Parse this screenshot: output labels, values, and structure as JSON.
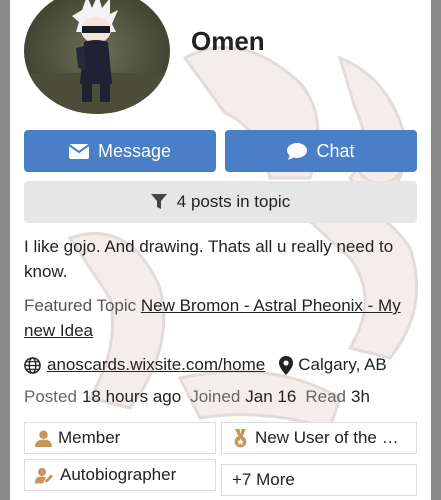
{
  "profile": {
    "username": "Omen",
    "bio": "I like gojo. And drawing. Thats all u really need to know.",
    "featured_label": "Featured Topic",
    "featured_topic": "New Bromon - Astral Pheonix - My new Idea",
    "website": "anoscards.wixsite.com/home",
    "location": "Calgary, AB"
  },
  "actions": {
    "message_label": "Message",
    "chat_label": "Chat",
    "posts_label": "4 posts in topic"
  },
  "stats": {
    "posted_label": "Posted",
    "posted_value": "18 hours ago",
    "joined_label": "Joined",
    "joined_value": "Jan 16",
    "read_label": "Read",
    "read_value": "3h"
  },
  "badges": [
    {
      "label": "Member",
      "icon": "user-icon",
      "color": "#c9955c"
    },
    {
      "label": "New User of the …",
      "icon": "medal-icon",
      "color": "#c9955c"
    },
    {
      "label": "Autobiographer",
      "icon": "user-edit-icon",
      "color": "#c9955c"
    },
    {
      "label": "+7 More"
    }
  ],
  "colors": {
    "primary_button": "#4a7fc7",
    "secondary_button": "#e6e6e6",
    "badge_bronze": "#c9955c"
  }
}
